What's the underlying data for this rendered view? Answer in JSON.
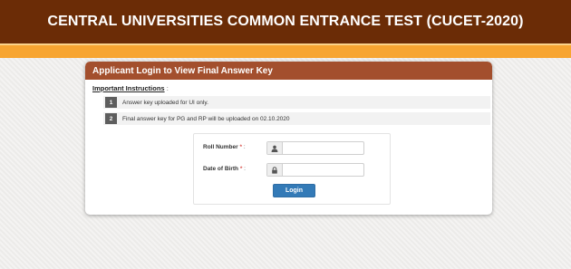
{
  "header": {
    "title": "CENTRAL UNIVERSITIES COMMON ENTRANCE TEST (CUCET-2020)"
  },
  "panel": {
    "title": "Applicant Login to View Final Answer Key"
  },
  "instructions": {
    "title": "Important Instructions",
    "colon": ":",
    "items": [
      {
        "num": "1",
        "text": "Answer key uploaded for UI only."
      },
      {
        "num": "2",
        "text": "Final answer key for PG and RP will be uploaded on 02.10.2020"
      }
    ]
  },
  "form": {
    "roll_label": "Roll Number",
    "dob_label": "Date of Birth",
    "required_mark": "*",
    "colon": ":",
    "roll_value": "",
    "dob_value": "",
    "login_label": "Login"
  },
  "colors": {
    "header_bg": "#6b2c06",
    "band": "#f7a531",
    "panel_head": "#a34f2d",
    "button": "#337ab7"
  }
}
